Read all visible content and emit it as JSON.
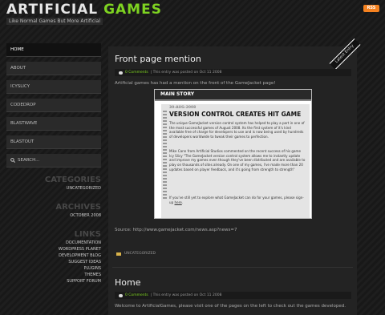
{
  "header": {
    "logo_part1": "ARTIFICIAL",
    "logo_part2": "GAMES",
    "tagline": "Like Normal Games But More Artificial",
    "rss_label": "RSS"
  },
  "nav": {
    "items": [
      "HOME",
      "ABOUT",
      "ICYSLICY",
      "CODEDROP",
      "BLASTWAVE",
      "BLASTOUT"
    ],
    "search_label": "SEARCH..."
  },
  "sidebar": {
    "categories_heading": "CATEGORIES",
    "categories": [
      "UNCATEGORIZED"
    ],
    "archives_heading": "ARCHIVES",
    "archives": [
      "OCTOBER 2008"
    ],
    "links_heading": "LINKS",
    "links": [
      "DOCUMENTATION",
      "WORDPRESS PLANET",
      "DEVELOPMENT BLOG",
      "SUGGEST IDEAS",
      "PLUGINS",
      "THEMES",
      "SUPPORT FORUM"
    ]
  },
  "latest_tag": "Latest Entry",
  "posts": [
    {
      "title": "Front page mention",
      "comments": "0 Comments",
      "meta": "| This entry was posted on Oct 11 2008",
      "intro": "Artificial games has had a mention on the front of the GameJacket page!",
      "source": "Source: http://www.gamejacket.com/news.asp?news=7",
      "category": "UNCATEGORIZED"
    },
    {
      "title": "Home",
      "comments": "0 Comments",
      "meta": "| This entry was posted on Oct 11 2008",
      "intro": "Welcome to ArtificialGames, please visit one of the pages on the left to check out the games developed."
    }
  ],
  "screenshot": {
    "bar_title": "MAIN STORY",
    "date": "30-AUG-2008",
    "headline": "VERSION CONTROL CREATES HIT GAME",
    "para1": "The unique GameJacket version control system has helped to play a part in one of the most successful games of August 2008. Its the first system of it's kind available free of charge for developers to use and is now being used by hundreds of developers worldwide to tweak their games to perfection.",
    "para2": "Mike Cann from Artificial Studios commented on the recent success of his game Icy Slicy \"The GameJacket version control system allows me to instantly update and improve my games even though they've been distributed and are available to play on thousands of sites already. On one of my games, I've made more than 20 updates based on player feedback, and it's going from strength to strength\"",
    "para3": "If you've still yet to explore what GameJacket can do for your games, please sign-up",
    "link": "here"
  }
}
